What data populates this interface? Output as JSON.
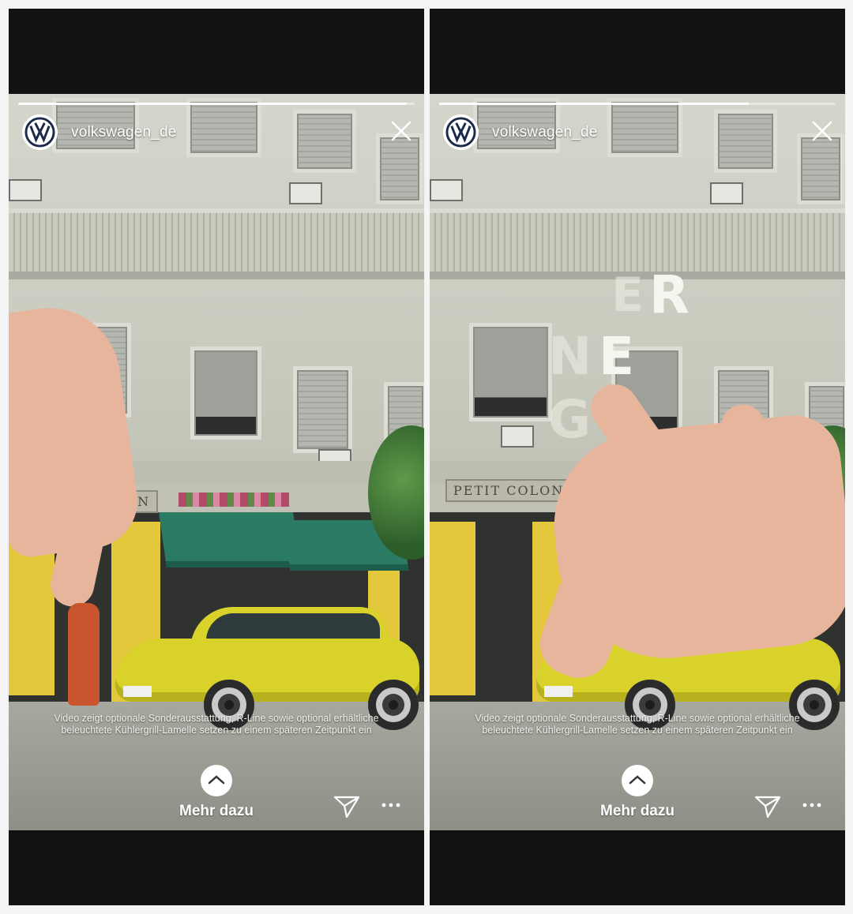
{
  "story_panels": [
    {
      "username": "volkswagen_de",
      "caption": "Video zeigt optionale Sonderausstattung, R-Line sowie optional erhältliche beleuchtete Kühlergrill-Lamelle setzen zu einem späteren Zeitpunkt ein",
      "cta_label": "Mehr dazu",
      "storefront_sign": "ON",
      "progress": 0.98
    },
    {
      "username": "volkswagen_de",
      "caption": "Video zeigt optionale Sonderausstattung, R-Line sowie optional erhältliche beleuchtete Kühlergrill-Lamelle setzen zu einem späteren Zeitpunkt ein",
      "cta_label": "Mehr dazu",
      "storefront_sign": "PETIT COLON",
      "overlay_letters": [
        "E",
        "R",
        "N",
        "E",
        "G"
      ],
      "progress": 0.78
    }
  ],
  "colors": {
    "car_yellow": "#d8d22a",
    "awning_green": "#2b7a63",
    "storefront_yellow": "#e2c83a",
    "background_black": "#121212"
  },
  "icons": {
    "brand_logo": "vw-logo-icon",
    "close": "close-icon",
    "swipe_up": "chevron-up-icon",
    "share": "send-icon",
    "more": "more-icon"
  }
}
